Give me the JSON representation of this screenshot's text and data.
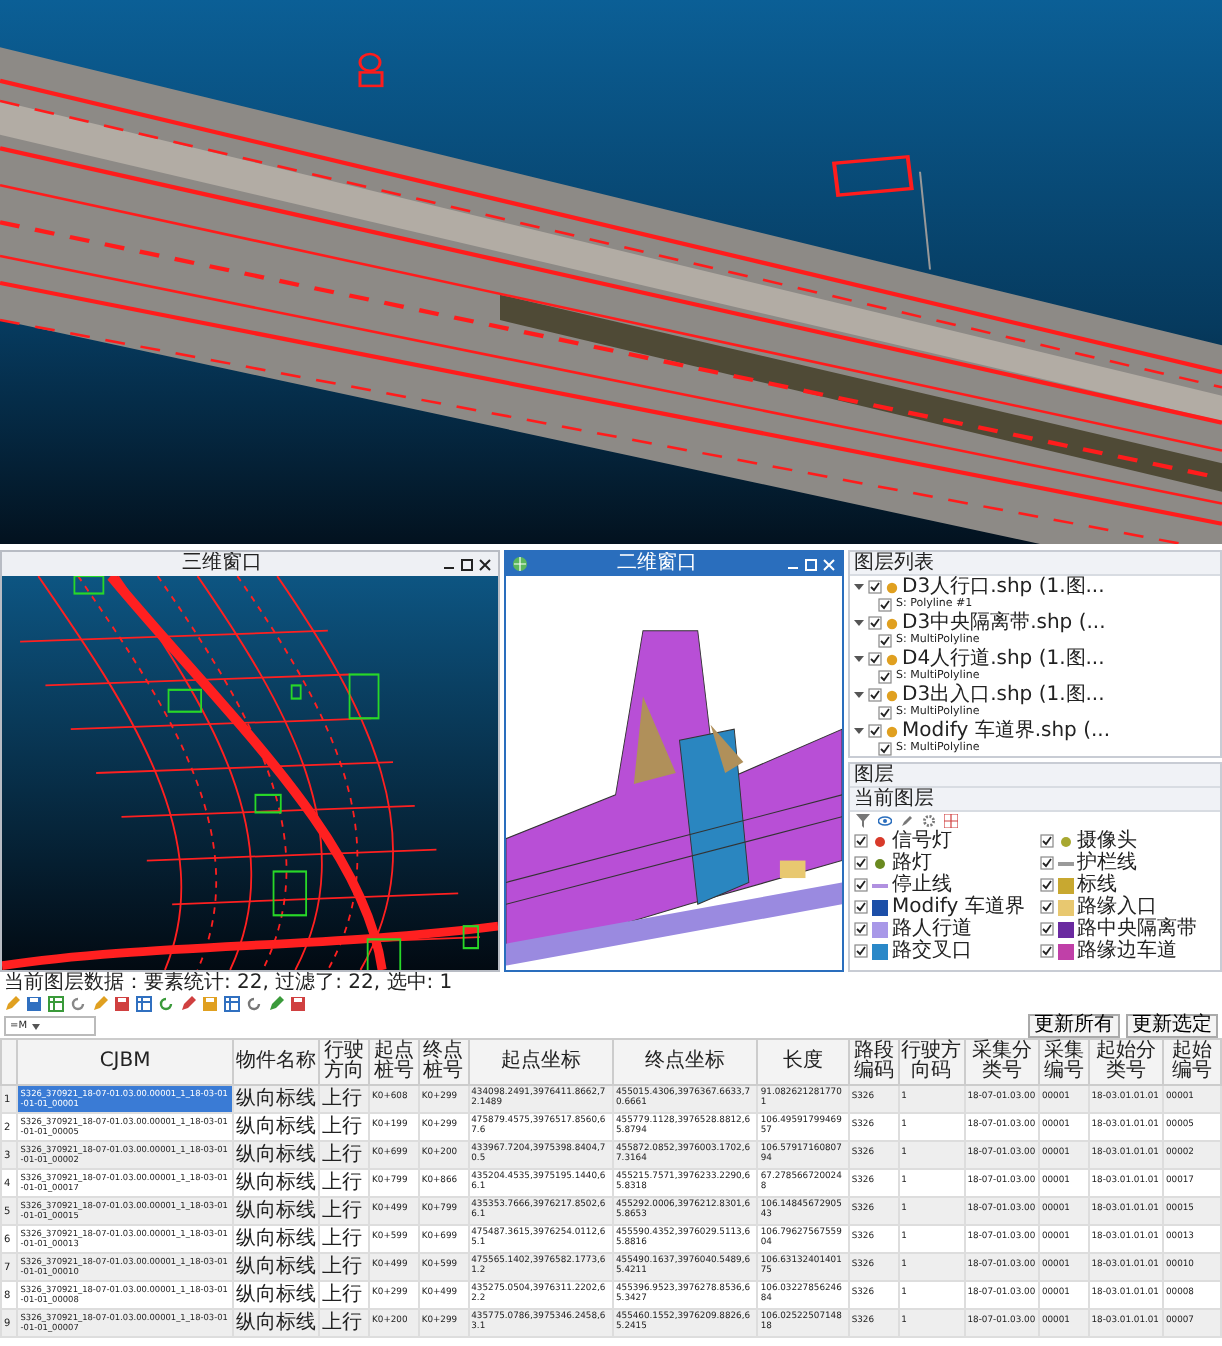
{
  "view_3d": {
    "title": "三维窗口"
  },
  "view_2d": {
    "title": "二维窗口"
  },
  "layer_tree": {
    "title": "图层列表",
    "items": [
      {
        "label": "D3人行口.shp (1.图...",
        "checked": true,
        "expanded": true,
        "children": [
          {
            "label": "S: Polyline #1",
            "checked": true
          }
        ]
      },
      {
        "label": "D3中央隔离带.shp (...",
        "checked": true,
        "expanded": true,
        "children": [
          {
            "label": "S: MultiPolyline",
            "checked": true
          }
        ]
      },
      {
        "label": "D4人行道.shp (1.图...",
        "checked": true,
        "expanded": true,
        "children": [
          {
            "label": "S: MultiPolyline",
            "checked": true
          }
        ]
      },
      {
        "label": "D3出入口.shp (1.图...",
        "checked": true,
        "expanded": true,
        "children": [
          {
            "label": "S: MultiPolyline",
            "checked": true
          }
        ]
      },
      {
        "label": "Modify 车道界.shp (...",
        "checked": true,
        "expanded": true,
        "children": [
          {
            "label": "S: MultiPolyline",
            "checked": true
          }
        ]
      }
    ]
  },
  "legend": {
    "tab": "图层",
    "title": "当前图层",
    "items": [
      {
        "label": "信号灯",
        "checked": true,
        "kind": "dot",
        "color": "#d83a2a"
      },
      {
        "label": "摄像头",
        "checked": true,
        "kind": "dot",
        "color": "#a8a830"
      },
      {
        "label": "路灯",
        "checked": true,
        "kind": "dot",
        "color": "#6a8a20"
      },
      {
        "label": "护栏线",
        "checked": true,
        "kind": "line",
        "color": "#9a9a9a"
      },
      {
        "label": "停止线",
        "checked": true,
        "kind": "line",
        "color": "#b090e0"
      },
      {
        "label": "标线",
        "checked": true,
        "kind": "fill",
        "color": "#c8a830"
      },
      {
        "label": "Modify 车道界",
        "checked": true,
        "kind": "fill",
        "color": "#1c4fa8"
      },
      {
        "label": "路缘入口",
        "checked": true,
        "kind": "fill",
        "color": "#e8c870"
      },
      {
        "label": "路人行道",
        "checked": true,
        "kind": "fill",
        "color": "#a898e8"
      },
      {
        "label": "路中央隔离带",
        "checked": true,
        "kind": "fill",
        "color": "#6a2aa0"
      },
      {
        "label": "路交叉口",
        "checked": true,
        "kind": "fill",
        "color": "#2a88c8"
      },
      {
        "label": "路缘边车道",
        "checked": true,
        "kind": "fill",
        "color": "#c040a8"
      }
    ]
  },
  "status_text": "当前图层数据：要素统计: 22, 过滤了: 22, 选中: 1",
  "filter": {
    "field": "=M",
    "buttons": [
      "更新所有",
      "更新选定"
    ]
  },
  "table": {
    "columns": [
      "CJBM",
      "物件名称",
      "行驶方向",
      "起点桩号",
      "终点桩号",
      "起点坐标",
      "终点坐标",
      "长度",
      "路段编码",
      "行驶方向码",
      "采集分类号",
      "采集编号",
      "起始分类号",
      "起始编号"
    ],
    "rows": [
      {
        "index": "1",
        "selected": true,
        "cells": [
          "S326_370921_18-07-01.03.00.00001_1_18-03-01-01-01_00001",
          "纵向标线",
          "上行",
          "K0+608",
          "K0+299",
          "434098.2491,3976411.8662,72.1489",
          "455015.4306,3976367.6633,70.6661",
          "91.0826212817701",
          "S326",
          "1",
          "18-07-01.03.00",
          "00001",
          "18-03.01.01.01",
          "00001"
        ]
      },
      {
        "index": "2",
        "selected": false,
        "cells": [
          "S326_370921_18-07-01.03.00.00001_1_18-03-01-01-01_00005",
          "纵向标线",
          "上行",
          "K0+199",
          "K0+299",
          "475879.4575,3976517.8560,67.6",
          "455779.1128,3976528.8812,65.8794",
          "106.4959179946957",
          "S326",
          "1",
          "18-07-01.03.00",
          "00001",
          "18-03.01.01.01",
          "00005"
        ]
      },
      {
        "index": "3",
        "selected": false,
        "cells": [
          "S326_370921_18-07-01.03.00.00001_1_18-03-01-01-01_00002",
          "纵向标线",
          "上行",
          "K0+699",
          "K0+200",
          "433967.7204,3975398.8404,70.5",
          "455872.0852,3976003.1702,67.3164",
          "106.5791716080794",
          "S326",
          "1",
          "18-07-01.03.00",
          "00001",
          "18-03.01.01.01",
          "00002"
        ]
      },
      {
        "index": "4",
        "selected": false,
        "cells": [
          "S326_370921_18-07-01.03.00.00001_1_18-03-01-01-01_00017",
          "纵向标线",
          "上行",
          "K0+799",
          "K0+866",
          "435204.4535,3975195.1440,66.1",
          "455215.7571,3976233.2290,65.8318",
          "67.2785667200248",
          "S326",
          "1",
          "18-07-01.03.00",
          "00001",
          "18-03.01.01.01",
          "00017"
        ]
      },
      {
        "index": "5",
        "selected": false,
        "cells": [
          "S326_370921_18-07-01.03.00.00001_1_18-03-01-01-01_00015",
          "纵向标线",
          "上行",
          "K0+499",
          "K0+799",
          "435353.7666,3976217.8502,66.1",
          "455292.0006,3976212.8301,65.8653",
          "106.1484567290543",
          "S326",
          "1",
          "18-07-01.03.00",
          "00001",
          "18-03.01.01.01",
          "00015"
        ]
      },
      {
        "index": "6",
        "selected": false,
        "cells": [
          "S326_370921_18-07-01.03.00.00001_1_18-03-01-01-01_00013",
          "纵向标线",
          "上行",
          "K0+599",
          "K0+699",
          "475487.3615,3976254.0112,65.1",
          "455590.4352,3976029.5113,65.8816",
          "106.7962756755904",
          "S326",
          "1",
          "18-07-01.03.00",
          "00001",
          "18-03.01.01.01",
          "00013"
        ]
      },
      {
        "index": "7",
        "selected": false,
        "cells": [
          "S326_370921_18-07-01.03.00.00001_1_18-03-01-01-01_00010",
          "纵向标线",
          "上行",
          "K0+499",
          "K0+599",
          "475565.1402,3976582.1773,61.2",
          "455490.1637,3976040.5489,65.4211",
          "106.6313240140175",
          "S326",
          "1",
          "18-07-01.03.00",
          "00001",
          "18-03.01.01.01",
          "00010"
        ]
      },
      {
        "index": "8",
        "selected": false,
        "cells": [
          "S326_370921_18-07-01.03.00.00001_1_18-03-01-01-01_00008",
          "纵向标线",
          "上行",
          "K0+299",
          "K0+499",
          "435275.0504,3976311.2202,62.2",
          "455396.9523,3976278.8536,65.3427",
          "106.0322785624684",
          "S326",
          "1",
          "18-07-01.03.00",
          "00001",
          "18-03.01.01.01",
          "00008"
        ]
      },
      {
        "index": "9",
        "selected": false,
        "cells": [
          "S326_370921_18-07-01.03.00.00001_1_18-03-01-01-01_00007",
          "纵向标线",
          "上行",
          "K0+200",
          "K0+299",
          "435775.0786,3975346.2458,63.1",
          "455460.1552,3976209.8826,65.2415",
          "106.0252250714818",
          "S326",
          "1",
          "18-07-01.03.00",
          "00001",
          "18-03.01.01.01",
          "00007"
        ]
      }
    ]
  }
}
